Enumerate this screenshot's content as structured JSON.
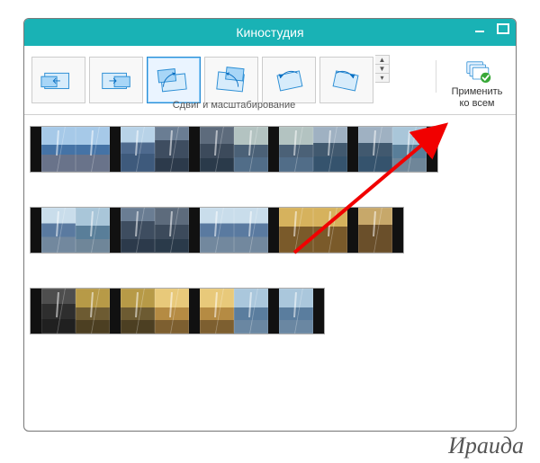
{
  "window": {
    "title": "Киностудия"
  },
  "ribbon": {
    "group_label": "Сдвиг и масштабирование",
    "apply_all_label": "Применить\nко всем",
    "gallery_items": [
      {
        "name": "pan-left"
      },
      {
        "name": "pan-right"
      },
      {
        "name": "zoom-in-tilt"
      },
      {
        "name": "zoom-out-rotate"
      },
      {
        "name": "rotate-left"
      },
      {
        "name": "rotate-right"
      }
    ],
    "selected_index": 2
  },
  "timeline": {
    "rows": [
      {
        "clips": [
          "p1",
          "p1",
          "p2",
          "p3",
          "p4",
          "p5",
          "p5",
          "p6",
          "p6",
          "p7"
        ]
      },
      {
        "clips": [
          "p8",
          "p7",
          "p3",
          "p4",
          "p8",
          "p8",
          "p14",
          "p14",
          "p13"
        ]
      },
      {
        "clips": [
          "p9",
          "p10",
          "p10",
          "p11",
          "p11",
          "p12",
          "p12"
        ]
      }
    ]
  },
  "watermark": "Ираида"
}
